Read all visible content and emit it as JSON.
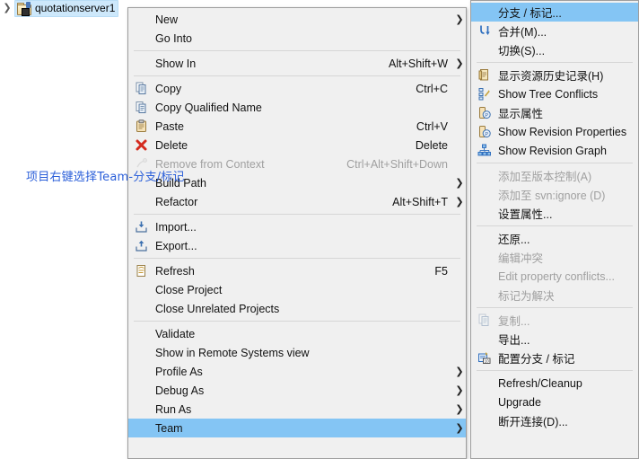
{
  "tree": {
    "expander_icon": "chevron-right-icon",
    "project_icon": "java-project-folder-icon",
    "label": "quotationserver1"
  },
  "annotation": {
    "text": "项目右键选择Team-分支/标记",
    "color": "#2b5fd9"
  },
  "colors": {
    "menu_bg": "#f0f0f0",
    "menu_border": "#9e9e9e",
    "highlight": "#84c5f4",
    "separator": "#d6d6d6",
    "disabled_text": "#a0a0a0",
    "text": "#111111",
    "tree_selection_bg": "#cde8fb"
  },
  "context_menu": {
    "name": "project-context-menu",
    "items": [
      {
        "type": "item",
        "label": "New",
        "accel": "",
        "icon": "",
        "submenu": true,
        "disabled": false,
        "selected": false
      },
      {
        "type": "item",
        "label": "Go Into",
        "accel": "",
        "icon": "",
        "submenu": false,
        "disabled": false,
        "selected": false
      },
      {
        "type": "separator"
      },
      {
        "type": "item",
        "label": "Show In",
        "accel": "Alt+Shift+W",
        "icon": "",
        "submenu": true,
        "disabled": false,
        "selected": false
      },
      {
        "type": "separator"
      },
      {
        "type": "item",
        "label": "Copy",
        "accel": "Ctrl+C",
        "icon": "copy-icon",
        "submenu": false,
        "disabled": false,
        "selected": false
      },
      {
        "type": "item",
        "label": "Copy Qualified Name",
        "accel": "",
        "icon": "copy-qualified-icon",
        "submenu": false,
        "disabled": false,
        "selected": false
      },
      {
        "type": "item",
        "label": "Paste",
        "accel": "Ctrl+V",
        "icon": "paste-icon",
        "submenu": false,
        "disabled": false,
        "selected": false
      },
      {
        "type": "item",
        "label": "Delete",
        "accel": "Delete",
        "icon": "delete-x-icon",
        "submenu": false,
        "disabled": false,
        "selected": false
      },
      {
        "type": "item",
        "label": "Remove from Context",
        "accel": "Ctrl+Alt+Shift+Down",
        "icon": "remove-context-icon",
        "submenu": false,
        "disabled": true,
        "selected": false
      },
      {
        "type": "item",
        "label": "Build Path",
        "accel": "",
        "icon": "",
        "submenu": true,
        "disabled": false,
        "selected": false
      },
      {
        "type": "item",
        "label": "Refactor",
        "accel": "Alt+Shift+T",
        "icon": "",
        "submenu": true,
        "disabled": false,
        "selected": false
      },
      {
        "type": "separator"
      },
      {
        "type": "item",
        "label": "Import...",
        "accel": "",
        "icon": "import-icon",
        "submenu": false,
        "disabled": false,
        "selected": false
      },
      {
        "type": "item",
        "label": "Export...",
        "accel": "",
        "icon": "export-icon",
        "submenu": false,
        "disabled": false,
        "selected": false
      },
      {
        "type": "separator"
      },
      {
        "type": "item",
        "label": "Refresh",
        "accel": "F5",
        "icon": "refresh-icon",
        "submenu": false,
        "disabled": false,
        "selected": false
      },
      {
        "type": "item",
        "label": "Close Project",
        "accel": "",
        "icon": "",
        "submenu": false,
        "disabled": false,
        "selected": false
      },
      {
        "type": "item",
        "label": "Close Unrelated Projects",
        "accel": "",
        "icon": "",
        "submenu": false,
        "disabled": false,
        "selected": false
      },
      {
        "type": "separator"
      },
      {
        "type": "item",
        "label": "Validate",
        "accel": "",
        "icon": "",
        "submenu": false,
        "disabled": false,
        "selected": false
      },
      {
        "type": "item",
        "label": "Show in Remote Systems view",
        "accel": "",
        "icon": "",
        "submenu": false,
        "disabled": false,
        "selected": false
      },
      {
        "type": "item",
        "label": "Profile As",
        "accel": "",
        "icon": "",
        "submenu": true,
        "disabled": false,
        "selected": false
      },
      {
        "type": "item",
        "label": "Debug As",
        "accel": "",
        "icon": "",
        "submenu": true,
        "disabled": false,
        "selected": false
      },
      {
        "type": "item",
        "label": "Run As",
        "accel": "",
        "icon": "",
        "submenu": true,
        "disabled": false,
        "selected": false
      },
      {
        "type": "item",
        "label": "Team",
        "accel": "",
        "icon": "",
        "submenu": true,
        "disabled": false,
        "selected": true
      }
    ]
  },
  "team_submenu": {
    "name": "team-submenu",
    "items": [
      {
        "type": "item",
        "label": "分支 / 标记...",
        "accel": "",
        "icon": "",
        "submenu": false,
        "disabled": false,
        "selected": true
      },
      {
        "type": "item",
        "label": "合并(M)...",
        "accel": "",
        "icon": "merge-arrow-icon",
        "submenu": false,
        "disabled": false,
        "selected": false
      },
      {
        "type": "item",
        "label": "切换(S)...",
        "accel": "",
        "icon": "",
        "submenu": false,
        "disabled": false,
        "selected": false
      },
      {
        "type": "separator"
      },
      {
        "type": "item",
        "label": "显示资源历史记录(H)",
        "accel": "",
        "icon": "history-icon",
        "submenu": false,
        "disabled": false,
        "selected": false
      },
      {
        "type": "item",
        "label": "Show Tree Conflicts",
        "accel": "",
        "icon": "tree-conflicts-icon",
        "submenu": false,
        "disabled": false,
        "selected": false
      },
      {
        "type": "item",
        "label": "显示属性",
        "accel": "",
        "icon": "properties-icon",
        "submenu": false,
        "disabled": false,
        "selected": false
      },
      {
        "type": "item",
        "label": "Show Revision Properties",
        "accel": "",
        "icon": "properties-icon",
        "submenu": false,
        "disabled": false,
        "selected": false
      },
      {
        "type": "item",
        "label": "Show Revision Graph",
        "accel": "",
        "icon": "revision-graph-icon",
        "submenu": false,
        "disabled": false,
        "selected": false
      },
      {
        "type": "separator"
      },
      {
        "type": "item",
        "label": "添加至版本控制(A)",
        "accel": "",
        "icon": "",
        "submenu": false,
        "disabled": true,
        "selected": false
      },
      {
        "type": "item",
        "label": "添加至 svn:ignore (D)",
        "accel": "",
        "icon": "",
        "submenu": false,
        "disabled": true,
        "selected": false
      },
      {
        "type": "item",
        "label": "设置属性...",
        "accel": "",
        "icon": "",
        "submenu": false,
        "disabled": false,
        "selected": false
      },
      {
        "type": "separator"
      },
      {
        "type": "item",
        "label": "还原...",
        "accel": "",
        "icon": "",
        "submenu": false,
        "disabled": false,
        "selected": false
      },
      {
        "type": "item",
        "label": "编辑冲突",
        "accel": "",
        "icon": "",
        "submenu": false,
        "disabled": true,
        "selected": false
      },
      {
        "type": "item",
        "label": "Edit property conflicts...",
        "accel": "",
        "icon": "",
        "submenu": false,
        "disabled": true,
        "selected": false
      },
      {
        "type": "item",
        "label": "标记为解决",
        "accel": "",
        "icon": "",
        "submenu": false,
        "disabled": true,
        "selected": false
      },
      {
        "type": "separator"
      },
      {
        "type": "item",
        "label": "复制...",
        "accel": "",
        "icon": "copy-icon",
        "submenu": false,
        "disabled": true,
        "selected": false
      },
      {
        "type": "item",
        "label": "导出...",
        "accel": "",
        "icon": "",
        "submenu": false,
        "disabled": false,
        "selected": false
      },
      {
        "type": "item",
        "label": "配置分支 / 标记",
        "accel": "",
        "icon": "configure-branch-icon",
        "submenu": false,
        "disabled": false,
        "selected": false
      },
      {
        "type": "separator"
      },
      {
        "type": "item",
        "label": "Refresh/Cleanup",
        "accel": "",
        "icon": "",
        "submenu": false,
        "disabled": false,
        "selected": false
      },
      {
        "type": "item",
        "label": "Upgrade",
        "accel": "",
        "icon": "",
        "submenu": false,
        "disabled": false,
        "selected": false
      },
      {
        "type": "item",
        "label": "断开连接(D)...",
        "accel": "",
        "icon": "",
        "submenu": false,
        "disabled": false,
        "selected": false
      }
    ]
  }
}
